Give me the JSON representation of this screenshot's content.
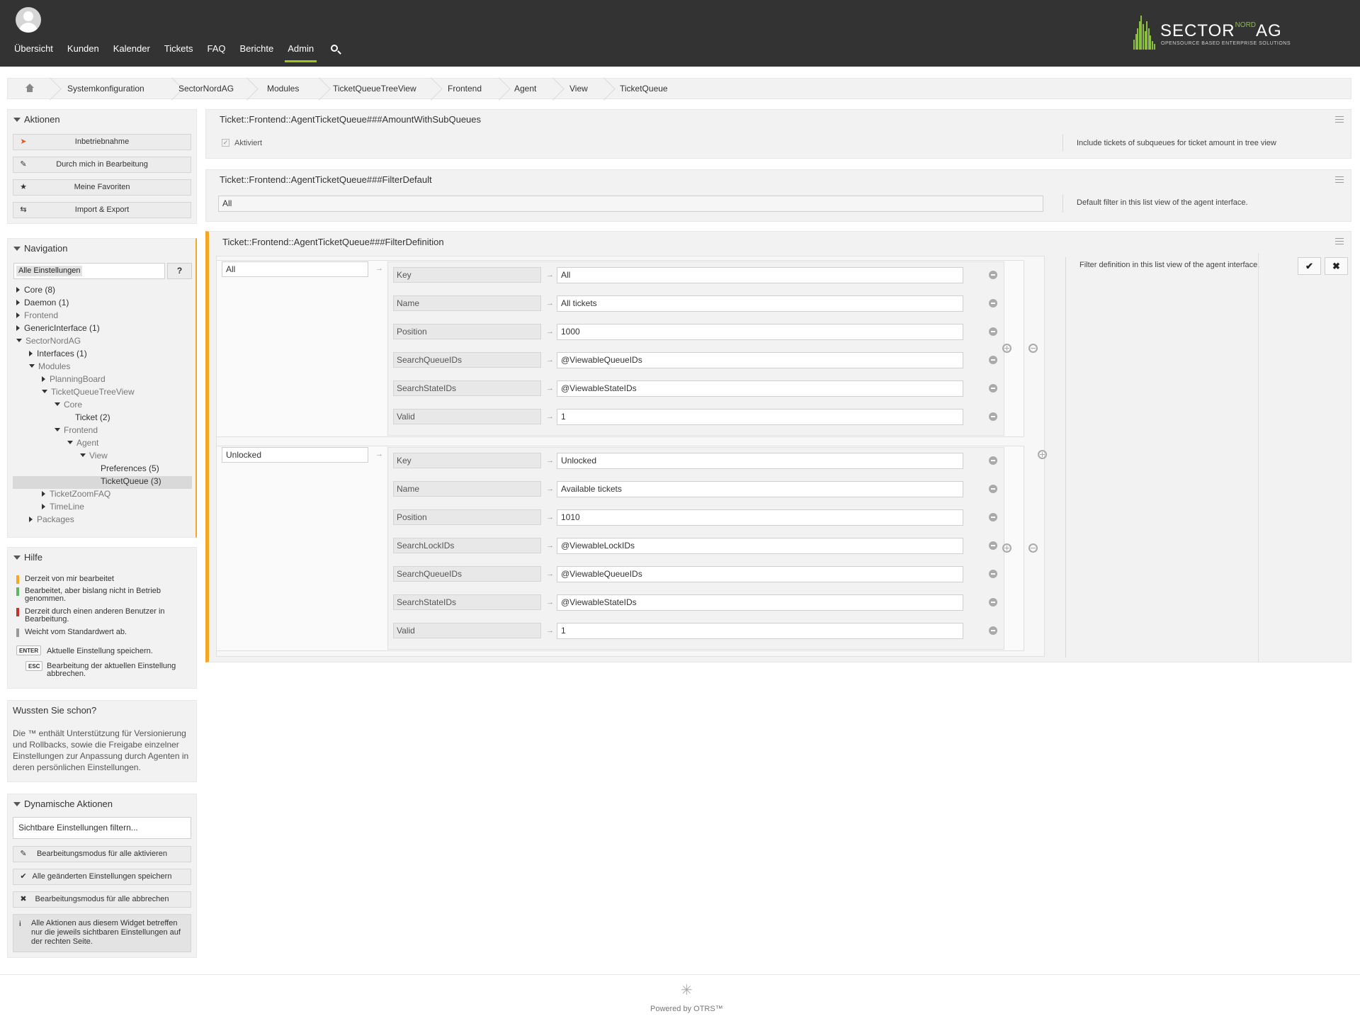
{
  "header": {
    "nav": [
      "Übersicht",
      "Kunden",
      "Kalender",
      "Tickets",
      "FAQ",
      "Berichte",
      "Admin"
    ],
    "active_nav": "Admin",
    "logo": {
      "word": "SECTOR",
      "nord": "NORD",
      "ag": "AG",
      "tagline": "OPENSOURCE BASED ENTERPRISE SOLUTIONS"
    },
    "brand_color": "#9fc21d"
  },
  "breadcrumb": [
    "Systemkonfiguration",
    "SectorNordAG",
    "Modules",
    "TicketQueueTreeView",
    "Frontend",
    "Agent",
    "View",
    "TicketQueue"
  ],
  "sidebar": {
    "actions": {
      "title": "Aktionen",
      "buttons": [
        "Inbetriebnahme",
        "Durch mich in Bearbeitung",
        "Meine Favoriten",
        "Import & Export"
      ]
    },
    "navigation": {
      "title": "Navigation",
      "search_selected": "Alle Einstellungen",
      "help_button": "?",
      "tree": [
        {
          "label": "Core (8)",
          "depth": 0,
          "state": "collapsed",
          "gray": false
        },
        {
          "label": "Daemon (1)",
          "depth": 0,
          "state": "collapsed",
          "gray": false
        },
        {
          "label": "Frontend",
          "depth": 0,
          "state": "collapsed",
          "gray": true
        },
        {
          "label": "GenericInterface (1)",
          "depth": 0,
          "state": "collapsed",
          "gray": false
        },
        {
          "label": "SectorNordAG",
          "depth": 0,
          "state": "expanded",
          "gray": true
        },
        {
          "label": "Interfaces (1)",
          "depth": 1,
          "state": "collapsed",
          "gray": false
        },
        {
          "label": "Modules",
          "depth": 1,
          "state": "expanded",
          "gray": true
        },
        {
          "label": "PlanningBoard",
          "depth": 2,
          "state": "collapsed",
          "gray": true
        },
        {
          "label": "TicketQueueTreeView",
          "depth": 2,
          "state": "expanded",
          "gray": true
        },
        {
          "label": "Core",
          "depth": 3,
          "state": "expanded",
          "gray": true
        },
        {
          "label": "Ticket (2)",
          "depth": 4,
          "state": "leaf",
          "gray": false
        },
        {
          "label": "Frontend",
          "depth": 3,
          "state": "expanded",
          "gray": true
        },
        {
          "label": "Agent",
          "depth": 4,
          "state": "expanded",
          "gray": true
        },
        {
          "label": "View",
          "depth": 5,
          "state": "expanded",
          "gray": true
        },
        {
          "label": "Preferences (5)",
          "depth": 6,
          "state": "leaf",
          "gray": false
        },
        {
          "label": "TicketQueue (3)",
          "depth": 6,
          "state": "leaf",
          "gray": false,
          "selected": true
        },
        {
          "label": "TicketZoomFAQ",
          "depth": 2,
          "state": "collapsed",
          "gray": true
        },
        {
          "label": "TimeLine",
          "depth": 2,
          "state": "collapsed",
          "gray": true
        },
        {
          "label": "Packages",
          "depth": 1,
          "state": "collapsed",
          "gray": true
        }
      ]
    },
    "help": {
      "title": "Hilfe",
      "legend": [
        {
          "color": "#f5a623",
          "text": "Derzeit von mir bearbeitet"
        },
        {
          "color": "#5cb85c",
          "text": "Bearbeitet, aber bislang nicht in Betrieb genommen."
        },
        {
          "color": "#c9302c",
          "text": "Derzeit durch einen anderen Benutzer in Bearbeitung."
        },
        {
          "color": "#999999",
          "text": "Weicht vom Standardwert ab."
        }
      ],
      "keys": [
        {
          "key": "ENTER",
          "text": "Aktuelle Einstellung speichern."
        },
        {
          "key": "ESC",
          "text": "Bearbeitung der aktuellen Einstellung abbrechen."
        }
      ]
    },
    "tip": {
      "title": "Wussten Sie schon?",
      "text": "Die ™ enthält Unterstützung für Versionierung und Rollbacks, sowie die Freigabe einzelner Einstellungen zur Anpassung durch Agenten in deren persönlichen Einstellungen."
    },
    "dynamic": {
      "title": "Dynamische Aktionen",
      "filter_placeholder": "Sichtbare Einstellungen filtern...",
      "buttons": [
        "Bearbeitungsmodus für alle aktivieren",
        "Alle geänderten Einstellungen speichern",
        "Bearbeitungsmodus für alle abbrechen"
      ],
      "info": "Alle Aktionen aus diesem Widget betreffen nur die jeweils sichtbaren Einstellungen auf der rechten Seite."
    }
  },
  "settings": [
    {
      "name": "Ticket::Frontend::AgentTicketQueue###AmountWithSubQueues",
      "checkbox_label": "Aktiviert",
      "description": "Include tickets of subqueues for ticket amount in tree view"
    },
    {
      "name": "Ticket::Frontend::AgentTicketQueue###FilterDefault",
      "value": "All",
      "description": "Default filter in this list view of the agent interface."
    },
    {
      "name": "Ticket::Frontend::AgentTicketQueue###FilterDefinition",
      "description": "Filter definition in this list view of the agent interface.",
      "editing_color": "#f5a623",
      "groups": [
        {
          "key": "All",
          "items": [
            {
              "key": "Key",
              "value": "All"
            },
            {
              "key": "Name",
              "value": "All tickets"
            },
            {
              "key": "Position",
              "value": "1000"
            },
            {
              "key": "SearchQueueIDs",
              "value": "@ViewableQueueIDs"
            },
            {
              "key": "SearchStateIDs",
              "value": "@ViewableStateIDs"
            },
            {
              "key": "Valid",
              "value": "1"
            }
          ]
        },
        {
          "key": "Unlocked",
          "items": [
            {
              "key": "Key",
              "value": "Unlocked"
            },
            {
              "key": "Name",
              "value": "Available tickets"
            },
            {
              "key": "Position",
              "value": "1010"
            },
            {
              "key": "SearchLockIDs",
              "value": "@ViewableLockIDs"
            },
            {
              "key": "SearchQueueIDs",
              "value": "@ViewableQueueIDs"
            },
            {
              "key": "SearchStateIDs",
              "value": "@ViewableStateIDs"
            },
            {
              "key": "Valid",
              "value": "1"
            }
          ]
        }
      ]
    }
  ],
  "footer": {
    "text": "Powered by OTRS™"
  }
}
